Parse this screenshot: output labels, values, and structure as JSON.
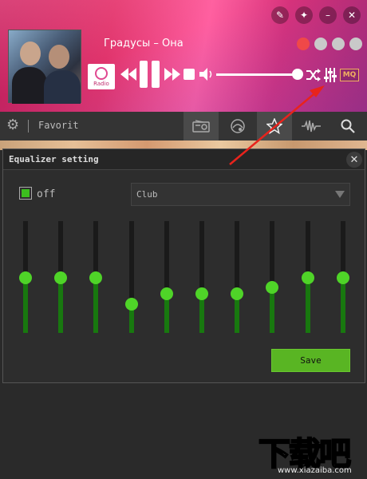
{
  "player": {
    "track_title": "Градусы – Она",
    "station_logo_text": "Radio",
    "quality_badge": "MQ",
    "volume_fraction": 1.0,
    "window_buttons": [
      "wrench-icon",
      "pin-icon",
      "minimize-icon",
      "close-icon"
    ],
    "share_dots": [
      {
        "name": "record-dot",
        "color": "#f04848"
      },
      {
        "name": "share-dot-1",
        "color": "#c9c9c9"
      },
      {
        "name": "share-dot-2",
        "color": "#c9c9c9"
      },
      {
        "name": "share-dot-3",
        "color": "#c9c9c9"
      }
    ]
  },
  "toolbar": {
    "favorite_label": "Favorit",
    "tabs": [
      "radio-icon",
      "genre-icon",
      "star-icon",
      "wave-icon",
      "search-icon"
    ],
    "active_tab": "star-icon"
  },
  "equalizer": {
    "title": "Equalizer setting",
    "enabled_label": "off",
    "preset": "Club",
    "save_label": "Save",
    "bands": [
      0.49,
      0.49,
      0.49,
      0.26,
      0.35,
      0.35,
      0.35,
      0.41,
      0.49,
      0.49
    ]
  },
  "colors": {
    "accent_green": "#4fd428",
    "save_green": "#59b523",
    "annotation_red": "#e8231c"
  },
  "watermark": {
    "brand_text": "下载吧",
    "site_text": "www.xiazaiba.com"
  }
}
